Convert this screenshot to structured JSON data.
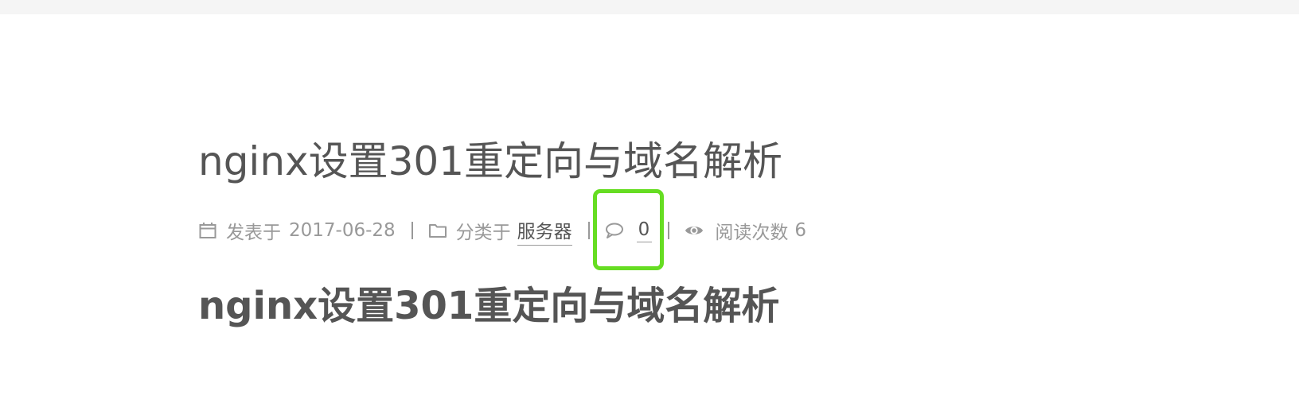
{
  "post": {
    "title": "nginx设置301重定向与域名解析",
    "meta": {
      "posted_label": "发表于",
      "posted_date": "2017-06-28",
      "category_label": "分类于",
      "category": "服务器",
      "comment_count": "0",
      "views_label": "阅读次数",
      "views_count": "6",
      "icons": [
        "calendar-icon",
        "folder-icon",
        "comment-icon",
        "eye-icon"
      ]
    },
    "content_heading": "nginx设置301重定向与域名解析"
  },
  "colors": {
    "title": "#555555",
    "meta": "#999999",
    "highlight": "#66dd22",
    "top_strip": "#f5f5f5"
  }
}
